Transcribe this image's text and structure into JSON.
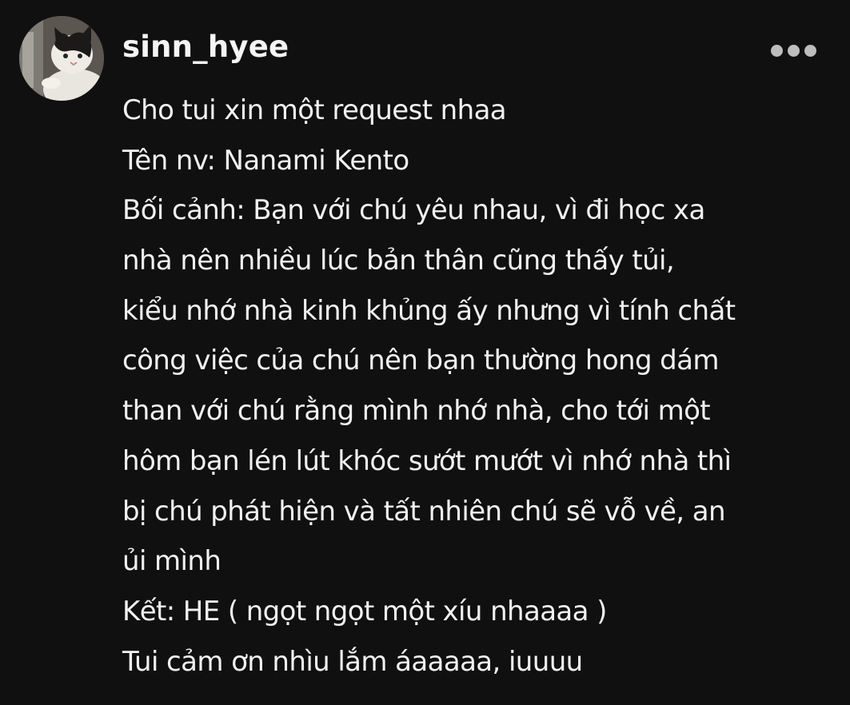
{
  "comment": {
    "username": "sinn_hyee",
    "avatar_icon": "cat-photo-avatar",
    "more_icon": "more-horizontal-icon",
    "lines": [
      "Cho tui xin một request nhaa",
      "Tên nv: Nanami Kento",
      "Bối cảnh: Bạn với chú yêu nhau, vì đi học xa",
      "nhà nên nhiều lúc bản thân cũng thấy tủi,",
      "kiểu nhớ nhà kinh khủng ấy nhưng vì tính chất",
      "công việc của chú nên bạn thường hong dám",
      "than với chú rằng mình nhớ nhà, cho tới một",
      "hôm bạn lén lút khóc sướt mướt vì nhớ nhà thì",
      "bị chú phát hiện và tất nhiên chú sẽ vỗ về, an",
      "ủi mình",
      "Kết: HE ( ngọt ngọt một xíu nhaaaa )",
      "Tui cảm ơn nhìu lắm áaaaaa, iuuuu"
    ]
  },
  "colors": {
    "background": "#101010",
    "text": "#f1f1f1",
    "more_dots": "#bdbdbd"
  }
}
